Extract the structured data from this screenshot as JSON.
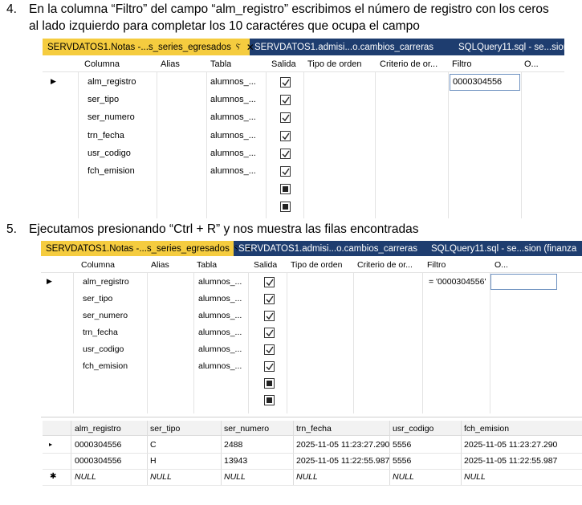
{
  "step4": {
    "number": "4.",
    "line1": "En la columna “Filtro” del campo “alm_registro” escribimos el número de registro con los ceros",
    "line2": "al lado izquierdo para completar los 10 caractéres que ocupa el campo"
  },
  "step5": {
    "number": "5.",
    "line1": "Ejecutamos presionando “Ctrl + R” y nos muestra las filas encontradas"
  },
  "tabs": {
    "active": "SERVDATOS1.Notas -...s_series_egresados",
    "pin": "Ⲋ",
    "close": "✕",
    "second": "SERVDATOS1.admisi...o.cambios_carreras",
    "third_a": "SQLQuery11.sql - se...sion",
    "third_b": "SQLQuery11.sql - se...sion (finanza"
  },
  "columns": [
    "Columna",
    "Alias",
    "Tabla",
    "Salida",
    "Tipo de orden",
    "Criterio de or...",
    "Filtro",
    "O..."
  ],
  "rows": [
    {
      "columna": "alm_registro",
      "tabla": "alumnos_..."
    },
    {
      "columna": "ser_tipo",
      "tabla": "alumnos_..."
    },
    {
      "columna": "ser_numero",
      "tabla": "alumnos_..."
    },
    {
      "columna": "trn_fecha",
      "tabla": "alumnos_..."
    },
    {
      "columna": "usr_codigo",
      "tabla": "alumnos_..."
    },
    {
      "columna": "fch_emision",
      "tabla": "alumnos_..."
    }
  ],
  "filter_step4": "0000304556",
  "filter_step5": "= '0000304556'",
  "results": {
    "headers": [
      "alm_registro",
      "ser_tipo",
      "ser_numero",
      "trn_fecha",
      "usr_codigo",
      "fch_emision"
    ],
    "rows": [
      [
        "0000304556",
        "C",
        "2488",
        "2025-11-05 11:23:27.290",
        "5556",
        "2025-11-05 11:23:27.290"
      ],
      [
        "0000304556",
        "H",
        "13943",
        "2025-11-05 11:22:55.987",
        "5556",
        "2025-11-05 11:22:55.987"
      ],
      [
        "NULL",
        "NULL",
        "NULL",
        "NULL",
        "NULL",
        "NULL"
      ]
    ]
  },
  "colors": {
    "tab_active": "#f5cc3f",
    "tabbar": "#1e3d6f"
  }
}
